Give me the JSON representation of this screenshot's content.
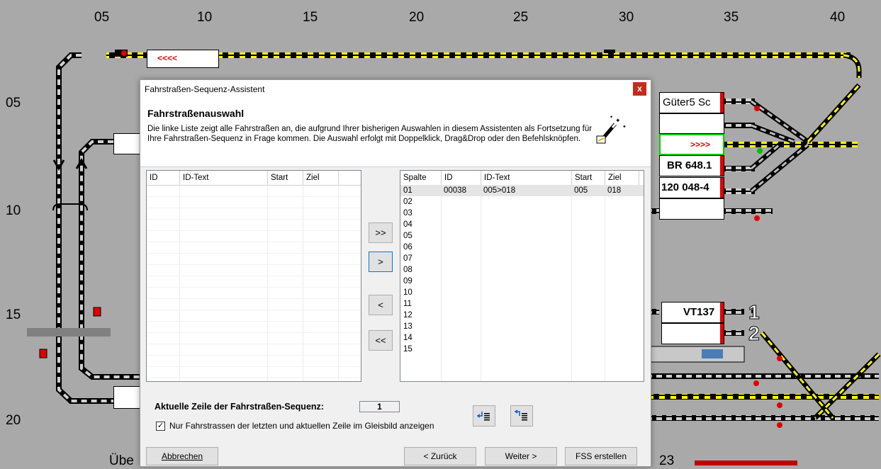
{
  "board": {
    "col_labels": [
      "05",
      "10",
      "15",
      "20",
      "25",
      "30",
      "35",
      "40"
    ],
    "row_labels": [
      "05",
      "10",
      "15",
      "20"
    ],
    "blocks": {
      "top_block": "<<<<",
      "gueter": "Güter5 Sc",
      "arrows_block": ">>>>",
      "br": "BR 648.1",
      "loco": "120 048-4",
      "vt": "VT137",
      "bottom_label": "Übe",
      "num_23": "23",
      "track_1": "1",
      "track_2": "2"
    },
    "colors": {
      "track_yellow": "#ffff00",
      "track_black": "#000000",
      "background": "#a9a9a9"
    }
  },
  "dialog": {
    "title": "Fahrstraßen-Sequenz-Assistent",
    "close_label": "x",
    "heading": "Fahrstraßenauswahl",
    "description": "Die linke Liste zeigt alle Fahrstraßen an, die aufgrund Ihrer bisherigen Auswahlen in diesem Assistenten als Fortsetzung für Ihre Fahrstraßen-Sequenz in Frage kommen. Die Auswahl erfolgt mit Doppelklick, Drag&Drop oder den Befehlsknöpfen.",
    "left_list": {
      "columns": [
        "ID",
        "ID-Text",
        "Start",
        "Ziel"
      ],
      "rows": []
    },
    "right_list": {
      "columns": [
        "Spalte",
        "ID",
        "ID-Text",
        "Start",
        "Ziel"
      ],
      "rows": [
        {
          "spalte": "01",
          "id": "00038",
          "text": "005>018",
          "start": "005",
          "ziel": "018"
        },
        {
          "spalte": "02",
          "id": "",
          "text": "",
          "start": "",
          "ziel": ""
        },
        {
          "spalte": "03",
          "id": "",
          "text": "",
          "start": "",
          "ziel": ""
        },
        {
          "spalte": "04",
          "id": "",
          "text": "",
          "start": "",
          "ziel": ""
        },
        {
          "spalte": "05",
          "id": "",
          "text": "",
          "start": "",
          "ziel": ""
        },
        {
          "spalte": "06",
          "id": "",
          "text": "",
          "start": "",
          "ziel": ""
        },
        {
          "spalte": "07",
          "id": "",
          "text": "",
          "start": "",
          "ziel": ""
        },
        {
          "spalte": "08",
          "id": "",
          "text": "",
          "start": "",
          "ziel": ""
        },
        {
          "spalte": "09",
          "id": "",
          "text": "",
          "start": "",
          "ziel": ""
        },
        {
          "spalte": "10",
          "id": "",
          "text": "",
          "start": "",
          "ziel": ""
        },
        {
          "spalte": "11",
          "id": "",
          "text": "",
          "start": "",
          "ziel": ""
        },
        {
          "spalte": "12",
          "id": "",
          "text": "",
          "start": "",
          "ziel": ""
        },
        {
          "spalte": "13",
          "id": "",
          "text": "",
          "start": "",
          "ziel": ""
        },
        {
          "spalte": "14",
          "id": "",
          "text": "",
          "start": "",
          "ziel": ""
        },
        {
          "spalte": "15",
          "id": "",
          "text": "",
          "start": "",
          "ziel": ""
        }
      ]
    },
    "move_buttons": {
      "add_all": ">>",
      "add_one": ">",
      "remove_one": "<",
      "remove_all": "<<"
    },
    "current_row_label": "Aktuelle Zeile der Fahrstraßen-Sequenz:",
    "current_row_value": "1",
    "checkbox_checked": true,
    "checkbox_mark": "✓",
    "checkbox_label": "Nur Fahrstrassen der letzten und aktuellen Zeile im Gleisbild anzeigen",
    "footer": {
      "cancel": "Abbrechen",
      "back": "< Zurück",
      "next": "Weiter >",
      "create": "FSS erstellen"
    }
  }
}
